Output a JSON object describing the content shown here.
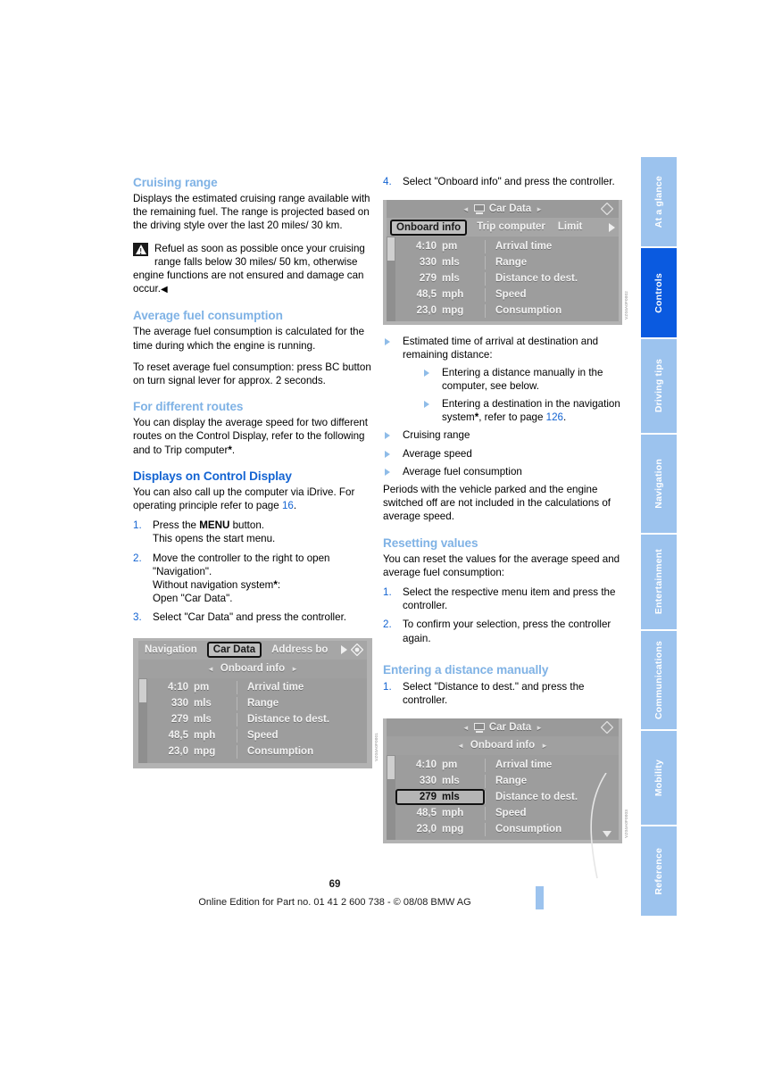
{
  "page": {
    "number": "69",
    "footer_text": "Online Edition for Part no. 01 41 2 600 738 - © 08/08 BMW AG"
  },
  "sidebar": {
    "tabs": [
      {
        "label": "At a glance",
        "active": false
      },
      {
        "label": "Controls",
        "active": true
      },
      {
        "label": "Driving tips",
        "active": false
      },
      {
        "label": "Navigation",
        "active": false
      },
      {
        "label": "Entertainment",
        "active": false
      },
      {
        "label": "Communications",
        "active": false
      },
      {
        "label": "Mobility",
        "active": false
      },
      {
        "label": "Reference",
        "active": false
      }
    ],
    "active_color": "#0a5ae0",
    "inactive_color": "#9cc3ee"
  },
  "left_column": {
    "cruising_range": {
      "heading": "Cruising range",
      "paragraph": "Displays the estimated cruising range available with the remaining fuel. The range is projected based on the driving style over the last 20 miles/ 30 km.",
      "warning": "Refuel as soon as possible once your cruising range falls below 30 miles/ 50 km, otherwise engine functions are not ensured and damage can occur.",
      "warning_end_mark": "◀"
    },
    "average_fuel_consumption": {
      "heading": "Average fuel consumption",
      "paragraph1": "The average fuel consumption is calculated for the time during which the engine is running.",
      "paragraph2": "To reset average fuel consumption: press BC button on turn signal lever for approx. 2 seconds."
    },
    "for_different_routes": {
      "heading": "For different routes",
      "paragraph_part1": "You can display the average speed for two different routes on the Control Display, refer to the following and to Trip computer",
      "asterisk": "*",
      "paragraph_part2": "."
    },
    "displays_on_control_display": {
      "heading": "Displays on Control Display",
      "paragraph_part1": "You can also call up the computer via iDrive. For operating principle refer to page ",
      "page_ref": "16",
      "paragraph_part2": ".",
      "steps": [
        {
          "num": "1.",
          "text_part1": "Press the ",
          "bold": "MENU",
          "text_part2": " button.",
          "sub": "This opens the start menu."
        },
        {
          "num": "2.",
          "text_part1": "Move the controller to the right to open \"Navigation\".",
          "sub1": "Without navigation system",
          "asterisk": "*",
          "sub1_end": ":",
          "sub2": "Open \"Car Data\"."
        },
        {
          "num": "3.",
          "text_part1": "Select \"Car Data\" and press the controller."
        }
      ]
    },
    "screenshot": {
      "tabs": [
        {
          "label": "Navigation",
          "selected": false
        },
        {
          "label": "Car Data",
          "selected": true
        },
        {
          "label": "Address bo",
          "selected": false
        }
      ],
      "subbar": {
        "arrow_left": "◄",
        "label": "Onboard info",
        "arrow_right": "►"
      },
      "rows": [
        {
          "value": "4:10",
          "unit": "pm",
          "label": "Arrival time",
          "highlighted": false
        },
        {
          "value": "330",
          "unit": "mls",
          "label": "Range",
          "highlighted": false
        },
        {
          "value": "279",
          "unit": "mls",
          "label": "Distance to dest.",
          "highlighted": false
        },
        {
          "value": "48,5",
          "unit": "mph",
          "label": "Speed",
          "highlighted": false
        },
        {
          "value": "23,0",
          "unit": "mpg",
          "label": "Consumption",
          "highlighted": false
        }
      ],
      "code": "VZ04A0F0001"
    }
  },
  "right_column": {
    "step4": {
      "num": "4.",
      "text": "Select \"Onboard info\" and press the controller."
    },
    "screenshot_top": {
      "titlebar": {
        "arrow_left": "◄",
        "label": "Car Data",
        "arrow_right": "►"
      },
      "tabs": [
        {
          "label": "Onboard info",
          "selected": true
        },
        {
          "label": "Trip computer",
          "selected": false
        },
        {
          "label": "Limit",
          "selected": false
        }
      ],
      "rows": [
        {
          "value": "4:10",
          "unit": "pm",
          "label": "Arrival time",
          "highlighted": false
        },
        {
          "value": "330",
          "unit": "mls",
          "label": "Range",
          "highlighted": false
        },
        {
          "value": "279",
          "unit": "mls",
          "label": "Distance to dest.",
          "highlighted": false
        },
        {
          "value": "48,5",
          "unit": "mph",
          "label": "Speed",
          "highlighted": false
        },
        {
          "value": "23,0",
          "unit": "mpg",
          "label": "Consumption",
          "highlighted": false
        }
      ],
      "code": "VZ04A0F0002"
    },
    "bullets": {
      "item1": "Estimated time of arrival at destination and remaining distance:",
      "sub1": "Entering a distance manually in the computer, see below.",
      "sub2_part1": "Entering a destination in the navigation system",
      "sub2_asterisk": "*",
      "sub2_part2": ", refer to page ",
      "sub2_page_ref": "126",
      "sub2_part3": ".",
      "item2": "Cruising range",
      "item3": "Average speed",
      "item4": "Average fuel consumption"
    },
    "periods_paragraph": "Periods with the vehicle parked and the engine switched off are not included in the calculations of average speed.",
    "resetting_values": {
      "heading": "Resetting values",
      "paragraph": "You can reset the values for the average speed and average fuel consumption:",
      "steps": [
        {
          "num": "1.",
          "text": "Select the respective menu item and press the controller."
        },
        {
          "num": "2.",
          "text": "To confirm your selection, press the controller again."
        }
      ]
    },
    "entering_a_distance_manually": {
      "heading": "Entering a distance manually",
      "steps": [
        {
          "num": "1.",
          "text": "Select \"Distance to dest.\" and press the controller."
        }
      ]
    },
    "screenshot_bottom": {
      "titlebar": {
        "arrow_left": "◄",
        "label": "Car Data",
        "arrow_right": "►"
      },
      "subbar": {
        "arrow_left": "◄",
        "label": "Onboard info",
        "arrow_right": "►"
      },
      "rows": [
        {
          "value": "4:10",
          "unit": "pm",
          "label": "Arrival time",
          "highlighted": false
        },
        {
          "value": "330",
          "unit": "mls",
          "label": "Range",
          "highlighted": false
        },
        {
          "value": "279",
          "unit": "mls",
          "label": "Distance to dest.",
          "highlighted": true
        },
        {
          "value": "48,5",
          "unit": "mph",
          "label": "Speed",
          "highlighted": false
        },
        {
          "value": "23,0",
          "unit": "mpg",
          "label": "Consumption",
          "highlighted": false
        }
      ],
      "code": "VZ04A0F0003"
    }
  }
}
